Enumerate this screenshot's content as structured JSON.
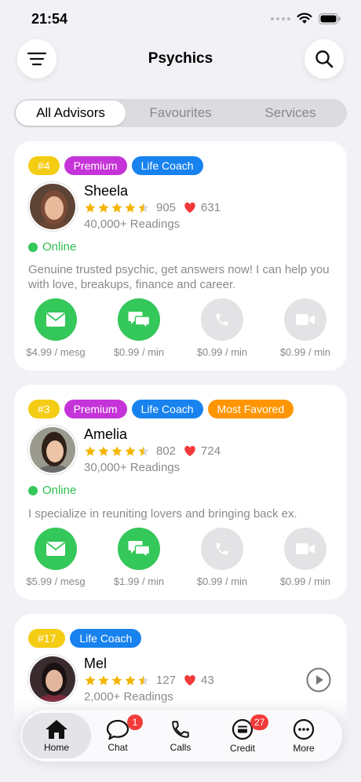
{
  "status_bar": {
    "time": "21:54"
  },
  "header": {
    "title": "Psychics"
  },
  "segments": [
    "All Advisors",
    "Favourites",
    "Services"
  ],
  "advisors": [
    {
      "rank": "#4",
      "badges": [
        "Premium",
        "Life Coach"
      ],
      "name": "Sheela",
      "rating": 4.5,
      "reviews": "905",
      "likes": "631",
      "readings": "40,000+ Readings",
      "status": "Online",
      "bio": "Genuine trusted psychic, get answers now! I can help you with love, breakups, finance and career.",
      "prices": [
        "$4.99 / mesg",
        "$0.99 / min",
        "$0.99 / min",
        "$0.99 / min"
      ]
    },
    {
      "rank": "#3",
      "badges": [
        "Premium",
        "Life Coach",
        "Most Favored"
      ],
      "name": "Amelia",
      "rating": 4.5,
      "reviews": "802",
      "likes": "724",
      "readings": "30,000+ Readings",
      "status": "Online",
      "bio": "I specialize in reuniting lovers and bringing back ex.",
      "prices": [
        "$5.99 / mesg",
        "$1.99 / min",
        "$0.99 / min",
        "$0.99 / min"
      ]
    },
    {
      "rank": "#17",
      "badges": [
        "Life Coach"
      ],
      "name": "Mel",
      "rating": 4.5,
      "reviews": "127",
      "likes": "43",
      "readings": "2,000+ Readings"
    }
  ],
  "tabbar": {
    "home": "Home",
    "chat": "Chat",
    "chat_badge": "1",
    "calls": "Calls",
    "credit": "Credit",
    "credit_badge": "27",
    "more": "More"
  },
  "colors": {
    "online": "#34c759",
    "rank": "#f5cc14",
    "premium": "#c534d8",
    "life_coach": "#1883ef",
    "most_favored": "#ff9500",
    "star": "#f5b400",
    "heart": "#f23a3a"
  }
}
